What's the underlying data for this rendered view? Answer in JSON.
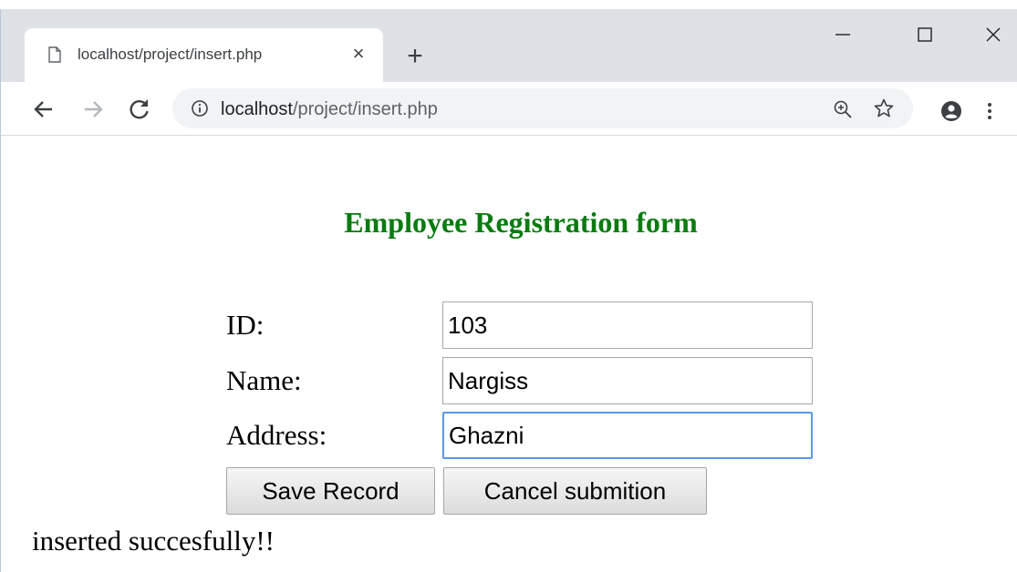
{
  "browser": {
    "tab_title": "localhost/project/insert.php",
    "new_tab_symbol": "+",
    "close_tab_symbol": "×",
    "url_host": "localhost",
    "url_path": "/project/insert.php",
    "icons": [
      "page-icon",
      "back-icon",
      "forward-icon",
      "reload-icon",
      "info-icon",
      "zoom-icon",
      "star-icon",
      "account-icon",
      "menu-icon",
      "minimize-icon",
      "maximize-icon",
      "close-icon"
    ]
  },
  "form": {
    "title": "Employee Registration form",
    "title_color": "#087b10",
    "id_label": "ID:",
    "id_value": "103",
    "name_label": "Name:",
    "name_value": "Nargiss",
    "address_label": "Address:",
    "address_value": "Ghazni",
    "save_label": "Save Record",
    "cancel_label": "Cancel submition"
  },
  "status": {
    "message": "inserted succesfully!!"
  }
}
